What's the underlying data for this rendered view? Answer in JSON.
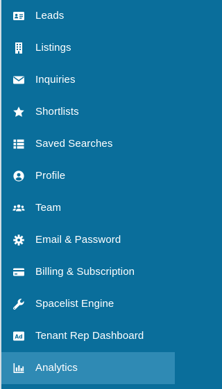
{
  "sidebar": {
    "items": [
      {
        "label": "Leads",
        "icon": "address-card-icon"
      },
      {
        "label": "Listings",
        "icon": "building-icon"
      },
      {
        "label": "Inquiries",
        "icon": "envelope-icon"
      },
      {
        "label": "Shortlists",
        "icon": "star-icon"
      },
      {
        "label": "Saved Searches",
        "icon": "list-icon"
      },
      {
        "label": "Profile",
        "icon": "user-circle-icon"
      },
      {
        "label": "Team",
        "icon": "users-icon"
      },
      {
        "label": "Email & Password",
        "icon": "gear-icon"
      },
      {
        "label": "Billing & Subscription",
        "icon": "credit-card-icon"
      },
      {
        "label": "Spacelist Engine",
        "icon": "wrench-icon"
      },
      {
        "label": "Tenant Rep Dashboard",
        "icon": "ad-icon"
      },
      {
        "label": "Analytics",
        "icon": "bar-chart-icon",
        "active": true
      }
    ]
  },
  "colors": {
    "background": "#0a6e9b",
    "active_background": "#2f8ab4",
    "text": "#ffffff"
  }
}
